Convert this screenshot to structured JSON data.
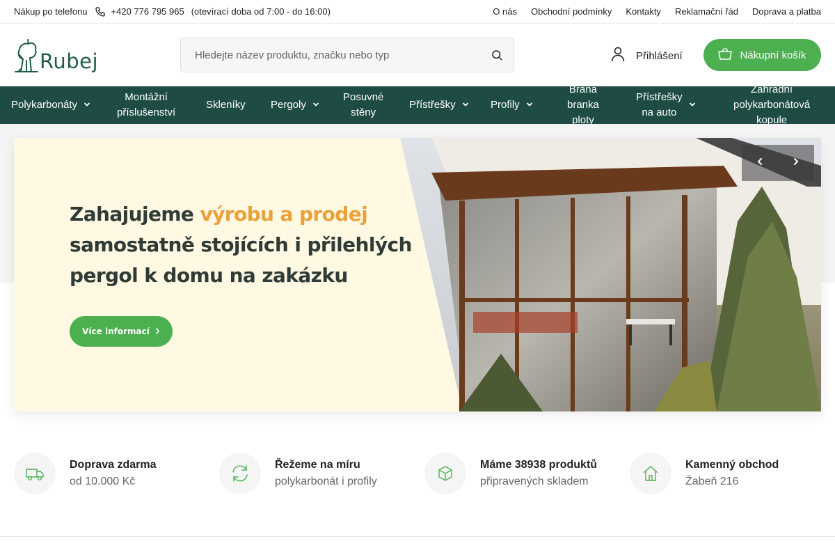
{
  "topbar": {
    "phone_label": "Nákup po telefonu",
    "phone_number": "+420 776 795 965",
    "hours": "(otevírací doba od 7:00 - do 16:00)",
    "links": [
      "O nás",
      "Obchodní podmínky",
      "Kontakty",
      "Reklamační řád",
      "Doprava a platba"
    ]
  },
  "header": {
    "logo_text": "Rubej",
    "search_placeholder": "Hledejte název produktu, značku nebo typ",
    "login_label": "Přihlášení",
    "cart_label": "Nákupní košík"
  },
  "nav": {
    "items": [
      {
        "label": "Polykarbonáty"
      },
      {
        "label": "Montážní\npříslušenství"
      },
      {
        "label": "Skleníky"
      },
      {
        "label": "Pergoly"
      },
      {
        "label": "Posuvné\nstěny"
      },
      {
        "label": "Přístřešky"
      },
      {
        "label": "Profily"
      },
      {
        "label": "Brána\nbranka\nploty"
      },
      {
        "label": "Přístřešky\nna auto"
      },
      {
        "label": "Zahradní\npolykarbonátová\nkopule"
      }
    ]
  },
  "hero": {
    "title_part1": "Zahajujeme ",
    "title_highlight": "výrobu a prodej",
    "title_line2": "samostatně stojících i přilehlých",
    "title_line3": "pergol k domu na zakázku",
    "button_label": "Více informací"
  },
  "features": [
    {
      "title": "Doprava zdarma",
      "subtitle": "od 10.000 Kč",
      "icon": "truck-icon"
    },
    {
      "title": "Řežeme na míru",
      "subtitle": "polykarbonát i profily",
      "icon": "refresh-icon"
    },
    {
      "title": "Máme 38938 produktů",
      "subtitle": "připravených skladem",
      "icon": "box-icon"
    },
    {
      "title": "Kamenný obchod",
      "subtitle": "Žabeň 216",
      "icon": "home-icon"
    }
  ],
  "colors": {
    "accent_green": "#4caf50",
    "nav_bg": "#1e4c44",
    "highlight_orange": "#e9a23b",
    "logo_green": "#1f5d45"
  }
}
